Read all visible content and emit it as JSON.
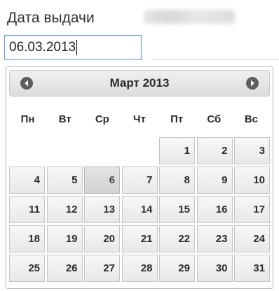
{
  "field": {
    "label": "Дата выдачи",
    "value": "06.03.2013"
  },
  "calendar": {
    "month_title": "Март 2013",
    "prev_icon": "chevron-left-icon",
    "next_icon": "chevron-right-icon",
    "weekdays": [
      "Пн",
      "Вт",
      "Ср",
      "Чт",
      "Пт",
      "Сб",
      "Вс"
    ],
    "leading_blanks": 4,
    "days": [
      "1",
      "2",
      "3",
      "4",
      "5",
      "6",
      "7",
      "8",
      "9",
      "10",
      "11",
      "12",
      "13",
      "14",
      "15",
      "16",
      "17",
      "18",
      "19",
      "20",
      "21",
      "22",
      "23",
      "24",
      "25",
      "26",
      "27",
      "28",
      "29",
      "30",
      "31"
    ],
    "current_day": "6",
    "colors": {
      "header_gradient_top": "#f0f0f0",
      "header_gradient_bottom": "#dcdcdc",
      "nav_button": "#5e5e5e",
      "input_border": "#6f9fd6"
    }
  }
}
